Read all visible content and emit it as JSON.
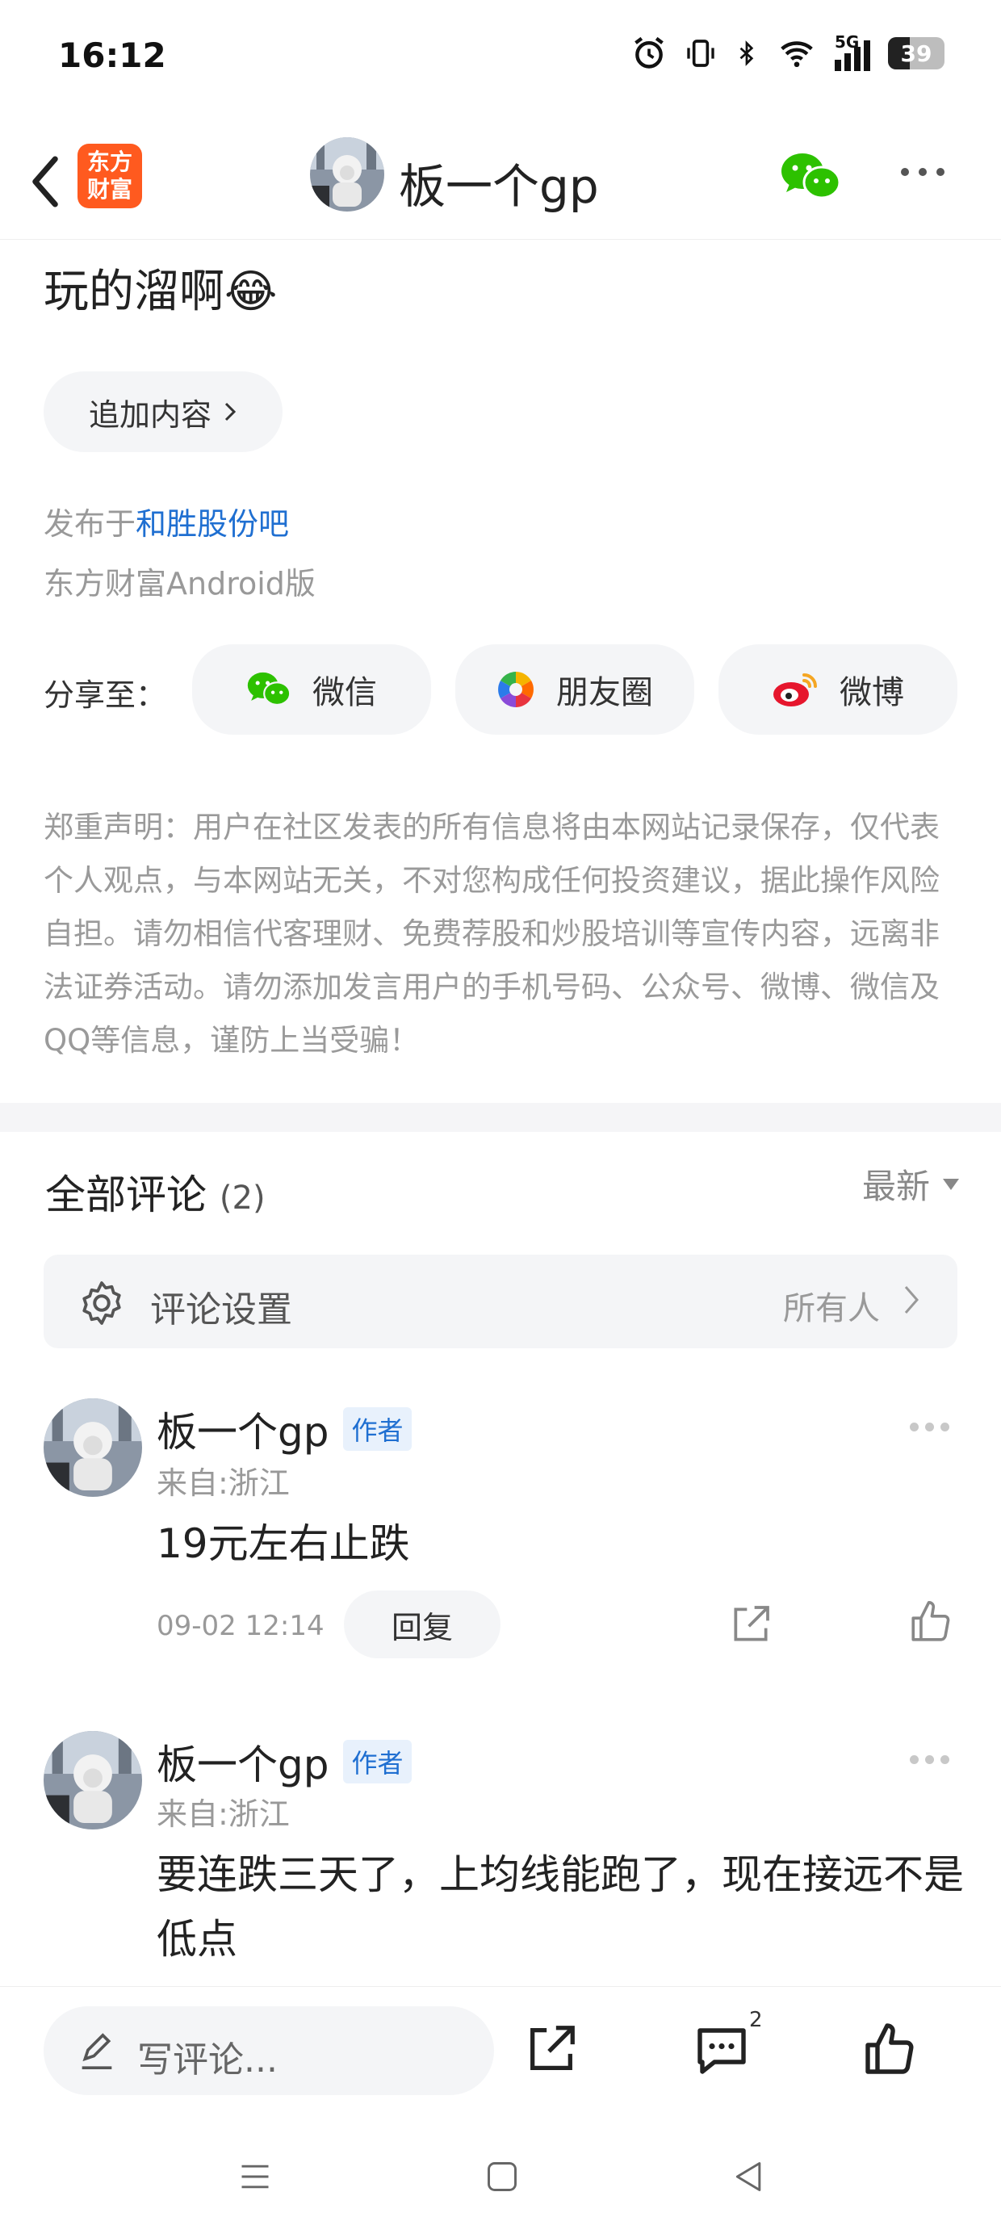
{
  "status_bar": {
    "time": "16:12",
    "network": "5G",
    "battery": "39"
  },
  "nav": {
    "back_icon": "chevron-left-icon",
    "app_logo": "东方\n财富",
    "username": "板一个gp"
  },
  "post": {
    "text": "玩的溜啊😂",
    "add_content_label": "追加内容",
    "published_prefix": "发布于",
    "published_bar": "和胜股份吧",
    "client": "东方财富Android版"
  },
  "share": {
    "label": "分享至：",
    "buttons": [
      {
        "label": "微信",
        "icon": "wechat-icon"
      },
      {
        "label": "朋友圈",
        "icon": "moments-icon"
      },
      {
        "label": "微博",
        "icon": "weibo-icon"
      }
    ]
  },
  "disclaimer": "郑重声明：用户在社区发表的所有信息将由本网站记录保存，仅代表个人观点，与本网站无关，不对您构成任何投资建议，据此操作风险自担。请勿相信代客理财、免费荐股和炒股培训等宣传内容，远离非法证券活动。请勿添加发言用户的手机号码、公众号、微博、微信及QQ等信息，谨防上当受骗！",
  "comments_section": {
    "title": "全部评论",
    "count": "(2)",
    "sort_label": "最新",
    "settings_label": "评论设置",
    "settings_value": "所有人",
    "comments": [
      {
        "name": "板一个gp",
        "badge": "作者",
        "location": "来自:浙江",
        "body": "19元左右止跌",
        "time": "09-02 12:14",
        "reply_label": "回复"
      },
      {
        "name": "板一个gp",
        "badge": "作者",
        "location": "来自:浙江",
        "body": "要连跌三天了，上均线能跑了，现在接远不是低点"
      }
    ]
  },
  "bottom_bar": {
    "write_placeholder": "写评论...",
    "comment_count": "2"
  },
  "colors": {
    "brand": "#ff5a1f",
    "link": "#1f6fd1",
    "wechat": "#2dc100",
    "weibo": "#e6162d"
  }
}
